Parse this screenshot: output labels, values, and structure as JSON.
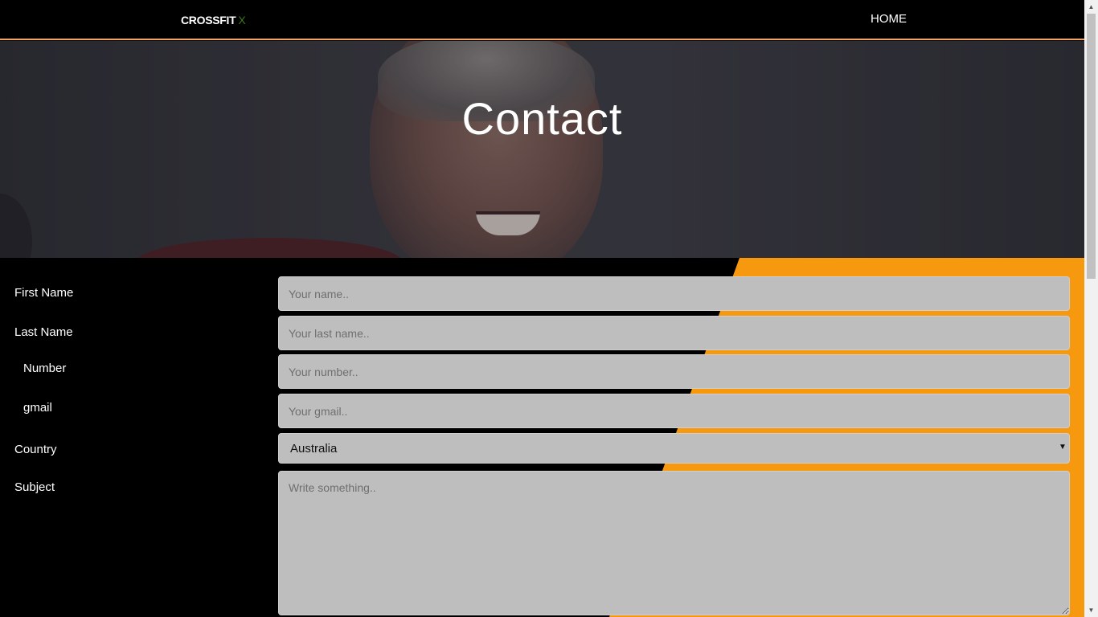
{
  "navbar": {
    "brand": "CROSSFIT",
    "brand_suffix": "X",
    "home": "HOME"
  },
  "hero": {
    "title": "Contact"
  },
  "form": {
    "first_name": {
      "label": "First Name",
      "placeholder": "Your name.."
    },
    "last_name": {
      "label": "Last Name",
      "placeholder": "Your last name.."
    },
    "number": {
      "label": "Number",
      "placeholder": "Your number.."
    },
    "gmail": {
      "label": "gmail",
      "placeholder": "Your gmail.."
    },
    "country": {
      "label": "Country",
      "value": "Australia"
    },
    "subject": {
      "label": "Subject",
      "placeholder": "Write something.."
    }
  },
  "colors": {
    "accent": "#f7990f",
    "nav_border": "#f4a460",
    "field_bg": "#bebebe"
  },
  "icons": {
    "select_arrow": "triangle-down",
    "scroll_up": "triangle-up",
    "scroll_down": "triangle-down"
  }
}
